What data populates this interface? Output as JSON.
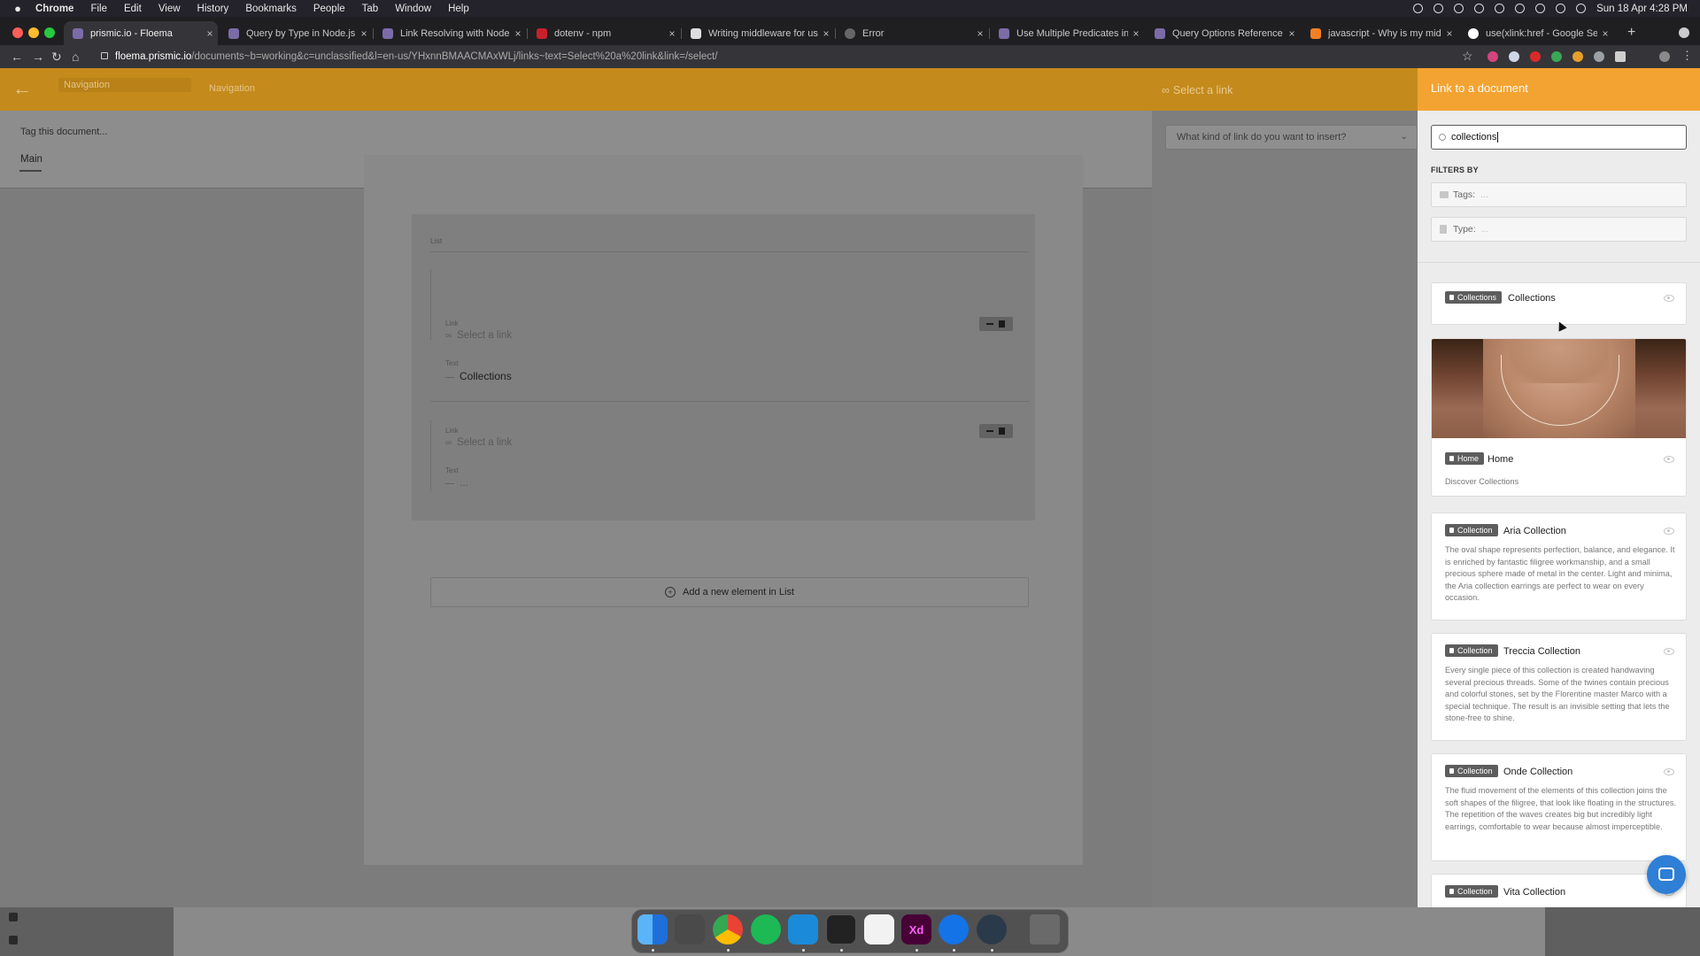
{
  "menubar": {
    "app": "Chrome",
    "items": [
      "File",
      "Edit",
      "View",
      "History",
      "Bookmarks",
      "People",
      "Tab",
      "Window",
      "Help"
    ],
    "clock": "Sun 18 Apr  4:28 PM"
  },
  "tabs": [
    {
      "title": "prismic.io - Floema",
      "active": true
    },
    {
      "title": "Query by Type in Node.js - Pr"
    },
    {
      "title": "Link Resolving with Node.js -"
    },
    {
      "title": "dotenv - npm"
    },
    {
      "title": "Writing middleware for use in"
    },
    {
      "title": "Error"
    },
    {
      "title": "Use Multiple Predicates in Ja"
    },
    {
      "title": "Query Options Reference in J"
    },
    {
      "title": "javascript - Why is my middle"
    },
    {
      "title": "use(xlink:href - Google Searc"
    }
  ],
  "address": {
    "url_host": "floema.prismic.io",
    "url_path": "/documents~b=working&c=unclassified&l=en-us/YHxnnBMAACMAxWLj/links~text=Select%20a%20link&link=/select/"
  },
  "header": {
    "nav_field": "Navigation",
    "nav_label": "Navigation",
    "select_link": "Select a link"
  },
  "editor": {
    "tag_text": "Tag this document...",
    "tab_main": "Main",
    "list_label": "List",
    "items": [
      {
        "link_label": "Link",
        "link_placeholder": "Select a link",
        "text_label": "Text",
        "text_value": "Collections"
      },
      {
        "link_label": "Link",
        "link_placeholder": "Select a link",
        "text_label": "Text",
        "text_value": "..."
      }
    ],
    "add_element": "Add a new element in List"
  },
  "link_kind": {
    "placeholder": "What kind of link do you want to insert?"
  },
  "panel": {
    "title": "Link to a document",
    "search_value": "collections",
    "filters_by": "FILTERS BY",
    "tags_label": "Tags:",
    "type_label": "Type:",
    "filter_placeholder": "...",
    "results": [
      {
        "type": "Collections",
        "title": "Collections"
      },
      {
        "type": "Home",
        "title": "Home",
        "desc": "Discover Collections"
      },
      {
        "type": "Collection",
        "title": "Aria Collection",
        "desc": "The oval shape represents perfection, balance, and elegance. It is enriched by fantastic filigree workmanship, and a small precious sphere made of metal in the center. Light and minima, the Aria collection earrings are perfect to wear on every occasion."
      },
      {
        "type": "Collection",
        "title": "Treccia Collection",
        "desc": "Every single piece of this collection is created handwaving several precious threads. Some of the twines contain precious and colorful stones, set by the Florentine master Marco with a special technique. The result is an invisible setting that lets the stone-free to shine."
      },
      {
        "type": "Collection",
        "title": "Onde Collection",
        "desc": "The fluid movement of the elements of this collection joins the soft shapes of the filigree, that look like floating in the structures. The repetition of the waves creates big but incredibly light earrings, comfortable to wear because almost imperceptible."
      },
      {
        "type": "Collection",
        "title": "Vita Collection"
      }
    ]
  },
  "dock": {
    "xd_label": "Xd"
  },
  "colors": {
    "header_orange": "#c58a1c",
    "panel_orange": "#f3a331",
    "chat_blue": "#2e7fd5"
  }
}
